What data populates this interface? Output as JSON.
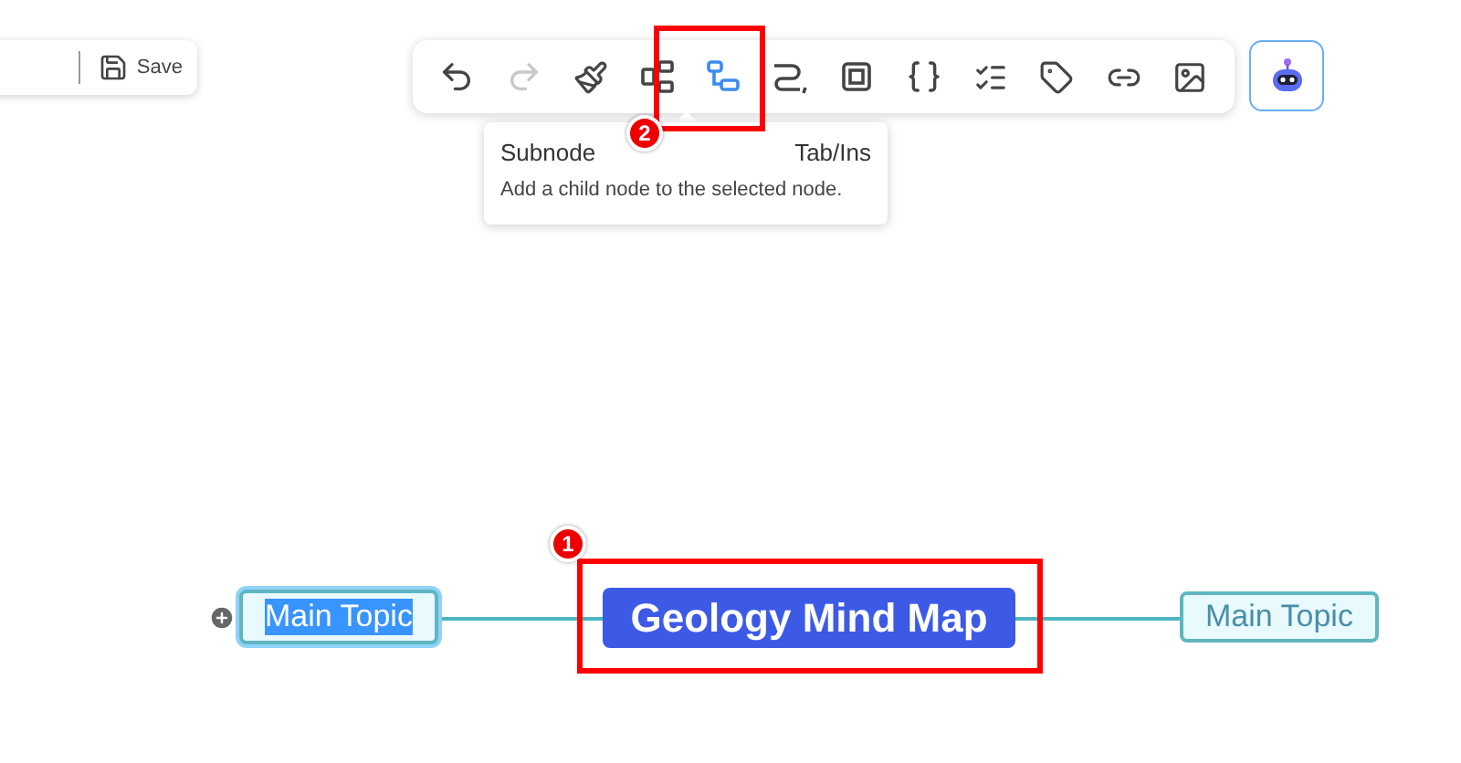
{
  "file_bar": {
    "save_label": "Save"
  },
  "toolbar": {
    "tools": [
      {
        "kind": "undo",
        "selected": false,
        "disabled": false
      },
      {
        "kind": "redo",
        "selected": false,
        "disabled": true
      },
      {
        "kind": "format",
        "selected": false,
        "disabled": false
      },
      {
        "kind": "structure",
        "selected": false,
        "disabled": false
      },
      {
        "kind": "subnode",
        "selected": true,
        "disabled": false
      },
      {
        "kind": "relation",
        "selected": false,
        "disabled": false
      },
      {
        "kind": "boundary",
        "selected": false,
        "disabled": false
      },
      {
        "kind": "summary",
        "selected": false,
        "disabled": false
      },
      {
        "kind": "note",
        "selected": false,
        "disabled": false
      },
      {
        "kind": "tag",
        "selected": false,
        "disabled": false
      },
      {
        "kind": "link",
        "selected": false,
        "disabled": false
      },
      {
        "kind": "image",
        "selected": false,
        "disabled": false
      }
    ]
  },
  "tooltip": {
    "title": "Subnode",
    "shortcut": "Tab/Ins",
    "description": "Add a child node to the selected node."
  },
  "mind_map": {
    "central": {
      "text": "Geology Mind Map"
    },
    "topics": [
      {
        "text": "Main Topic",
        "kind": "left",
        "selected": true
      },
      {
        "text": "Main Topic",
        "kind": "right",
        "selected": false
      }
    ]
  },
  "annotations": [
    {
      "number": "2",
      "kind": "toolbar"
    },
    {
      "number": "1",
      "kind": "central"
    }
  ]
}
